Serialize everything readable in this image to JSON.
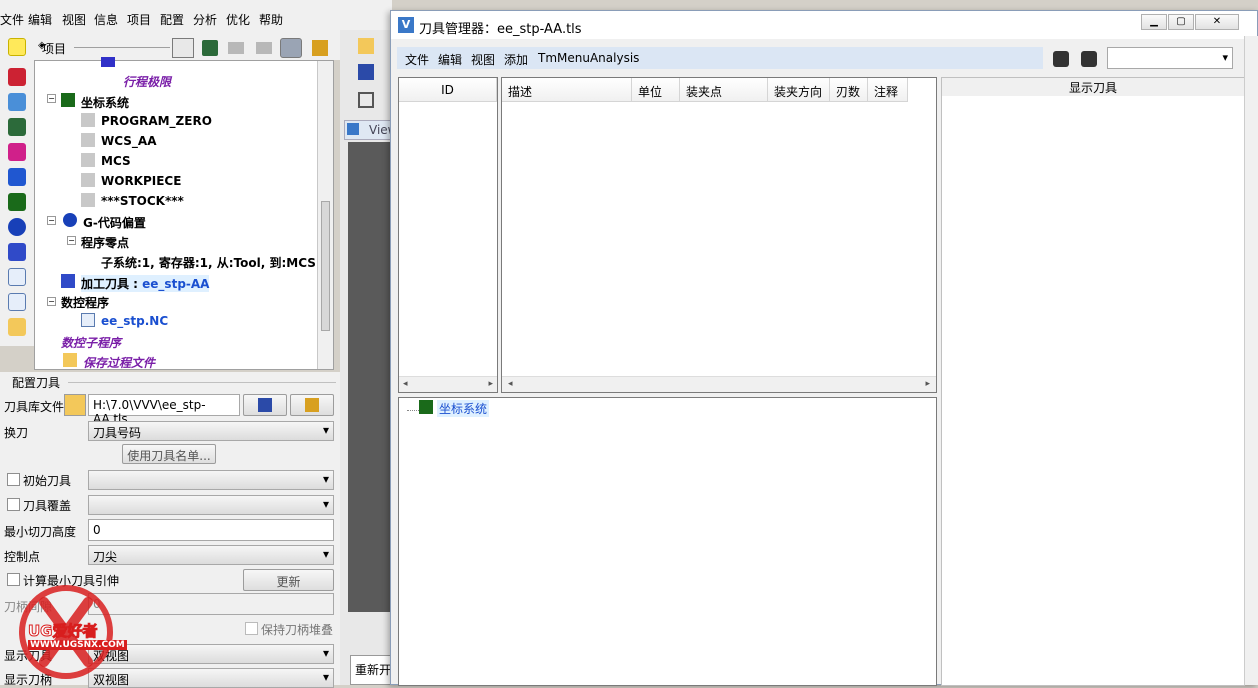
{
  "main_menu": [
    "文件",
    "编辑",
    "视图",
    "信息",
    "项目",
    "配置",
    "分析",
    "优化",
    "帮助"
  ],
  "project_panel": {
    "title": "项目"
  },
  "tree": {
    "items": [
      {
        "label": "行程极限",
        "style": "purple-italic"
      },
      {
        "label": "坐标系统",
        "style": "bold"
      },
      {
        "label": "PROGRAM_ZERO",
        "style": "normal"
      },
      {
        "label": "WCS_AA",
        "style": "normal"
      },
      {
        "label": "MCS",
        "style": "normal"
      },
      {
        "label": "WORKPIECE",
        "style": "normal"
      },
      {
        "label": "***STOCK***",
        "style": "normal"
      },
      {
        "label": "G-代码偏置",
        "style": "bold"
      },
      {
        "label": "程序零点",
        "style": "bold"
      },
      {
        "label": "子系统:1, 寄存器:1, 从:Tool, 到:MCS",
        "style": "normal"
      },
      {
        "label": "加工刀具 : ",
        "style": "bold"
      },
      {
        "label": "ee_stp-AA",
        "style": "link"
      },
      {
        "label": "数控程序",
        "style": "bold"
      },
      {
        "label": "ee_stp.NC",
        "style": "link"
      },
      {
        "label": "数控子程序",
        "style": "purple-italic"
      },
      {
        "label": "保存过程文件",
        "style": "purple-italic"
      }
    ]
  },
  "config_tool": {
    "section_title": "配置刀具",
    "library_label": "刀具库文件",
    "library_path": "H:\\7.0\\VVV\\ee_stp-AA.tls",
    "tool_change_label": "换刀",
    "tool_change_value": "刀具号码",
    "use_tool_names_button": "使用刀具名单...",
    "initial_tool_label": "初始刀具",
    "tool_override_label": "刀具覆盖",
    "min_cut_height_label": "最小切刀高度",
    "min_cut_height_value": "0",
    "control_point_label": "控制点",
    "control_point_value": "刀尖",
    "calc_min_extension_label": "计算最小刀具引伸",
    "update_button": "更新",
    "tool_clearance_label": "刀柄间隙",
    "tool_clearance_value": "0",
    "keep_holder_stack_label": "保持刀柄堆叠",
    "show_label": "显示刀具",
    "show_value": "双视图",
    "show_holder_label": "显示刀柄",
    "show_holder_value": "双视图"
  },
  "middle": {
    "view_tab": "View",
    "restart_button": "重新开"
  },
  "tool_manager": {
    "title": "刀具管理器：ee_stp-AA.tls",
    "menu": [
      "文件",
      "编辑",
      "视图",
      "添加",
      "TmMenuAnalysis"
    ],
    "id_header": "ID",
    "columns": [
      "描述",
      "单位",
      "装夹点",
      "装夹方向",
      "刃数",
      "注释"
    ],
    "tree_root": "坐标系统",
    "display_panel_title": "显示刀具"
  },
  "watermark": {
    "brand": "UG爱好者",
    "url": "WWW.UGSNX.COM"
  }
}
